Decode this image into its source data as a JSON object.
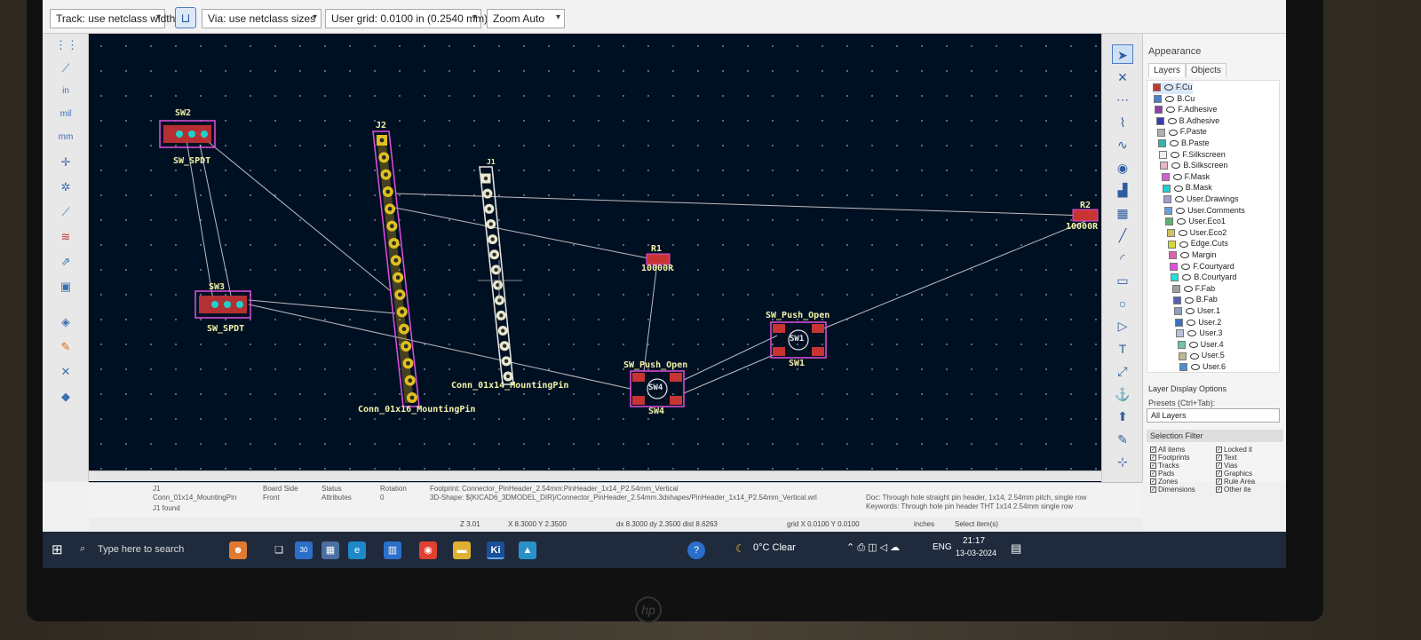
{
  "toolbar": {
    "track_select": "Track: use netclass width",
    "via_select": "Via: use netclass sizes",
    "grid_select": "User grid: 0.0100 in (0.2540 mm)",
    "zoom_select": "Zoom Auto"
  },
  "left_tools": [
    "grid-icon",
    "ruler-icon",
    "in",
    "mil",
    "mm",
    "cursor-icon",
    "ratsnest-icon",
    "via-icon",
    "track-icon",
    "zone-icon",
    "pad-icon",
    "3d-icon",
    "graphics-icon",
    "cross-icon",
    "layer-icon"
  ],
  "left_tool_labels": {
    "in": "in",
    "mil": "mil",
    "mm": "mm"
  },
  "right_tools": [
    "select-icon",
    "highlight-icon",
    "route-icon",
    "diff-pair-icon",
    "tune-icon",
    "via-icon",
    "zone-icon",
    "keepout-icon",
    "line-icon",
    "arc-icon",
    "rect-icon",
    "circle-icon",
    "polygon-icon",
    "text-icon",
    "dimension-icon",
    "anchor-icon",
    "origin-icon",
    "measure-icon",
    "grid-origin-icon"
  ],
  "appearance": {
    "title": "Appearance",
    "tab_layers": "Layers",
    "tab_objects": "Objects",
    "layers": [
      {
        "name": "F.Cu",
        "color": "#c83434"
      },
      {
        "name": "B.Cu",
        "color": "#4d7fc4"
      },
      {
        "name": "F.Adhesive",
        "color": "#8e3ea6"
      },
      {
        "name": "B.Adhesive",
        "color": "#3a3bb0"
      },
      {
        "name": "F.Paste",
        "color": "#b0b0b0"
      },
      {
        "name": "B.Paste",
        "color": "#32b6b0"
      },
      {
        "name": "F.Silkscreen",
        "color": "#f0f0f0"
      },
      {
        "name": "B.Silkscreen",
        "color": "#e8b4c8"
      },
      {
        "name": "F.Mask",
        "color": "#d060d0"
      },
      {
        "name": "B.Mask",
        "color": "#20d0d0"
      },
      {
        "name": "User.Drawings",
        "color": "#9aa0c8"
      },
      {
        "name": "User.Comments",
        "color": "#6aa0d8"
      },
      {
        "name": "User.Eco1",
        "color": "#60b070"
      },
      {
        "name": "User.Eco2",
        "color": "#d0c060"
      },
      {
        "name": "Edge.Cuts",
        "color": "#d8d838"
      },
      {
        "name": "Margin",
        "color": "#e060b0"
      },
      {
        "name": "F.Courtyard",
        "color": "#e050e0"
      },
      {
        "name": "B.Courtyard",
        "color": "#20e0e0"
      },
      {
        "name": "F.Fab",
        "color": "#a0a0a0"
      },
      {
        "name": "B.Fab",
        "color": "#5860b0"
      },
      {
        "name": "User.1",
        "color": "#8aa0c0"
      },
      {
        "name": "User.2",
        "color": "#3a70c0"
      },
      {
        "name": "User.3",
        "color": "#b8c0d8"
      },
      {
        "name": "User.4",
        "color": "#70c0b0"
      },
      {
        "name": "User.5",
        "color": "#c0b890"
      },
      {
        "name": "User.6",
        "color": "#4a90d0"
      }
    ],
    "layer_display_options": "Layer Display Options",
    "presets_label": "Presets (Ctrl+Tab):",
    "presets_value": "All Layers",
    "selection_filter": "Selection Filter",
    "filters": [
      {
        "label": "All items",
        "checked": true
      },
      {
        "label": "Locked it",
        "checked": true
      },
      {
        "label": "Footprints",
        "checked": true
      },
      {
        "label": "Text",
        "checked": true
      },
      {
        "label": "Tracks",
        "checked": true
      },
      {
        "label": "Vias",
        "checked": true
      },
      {
        "label": "Pads",
        "checked": true
      },
      {
        "label": "Graphics",
        "checked": true
      },
      {
        "label": "Zones",
        "checked": true
      },
      {
        "label": "Rule Area",
        "checked": true
      },
      {
        "label": "Dimensions",
        "checked": true
      },
      {
        "label": "Other ite",
        "checked": true
      }
    ]
  },
  "pcb": {
    "sw2_ref": "SW2",
    "sw2_val": "SW_SPDT",
    "sw3_ref": "SW3",
    "sw3_val": "SW_SPDT",
    "j2_ref": "J2",
    "j2_val": "Conn_01x16_MountingPin",
    "j1_ref": "J1",
    "j1_val": "Conn_01x14_MountingPin",
    "r1_ref": "R1",
    "r1_val": "10000R",
    "r2_ref": "R2",
    "r2_val": "10000R",
    "sw4_ref": "SW4",
    "sw4_val": "SW_Push_Open",
    "sw4_center": "SW4",
    "sw1_ref": "SW1",
    "sw1_val": "SW_Push_Open",
    "sw1_center": "SW1"
  },
  "message_panel": {
    "ref": "J1",
    "value": "Conn_01x14_MountingPin",
    "found": "J1 found",
    "board_side_label": "Board Side",
    "board_side_value": "Front",
    "status_label": "Status",
    "attributes_label": "Attributes",
    "rotation_label": "Rotation",
    "rotation_value": "0",
    "footprint": "Footprint: Connector_PinHeader_2.54mm:PinHeader_1x14_P2.54mm_Vertical",
    "shape3d": "3D-Shape: ${KICAD6_3DMODEL_DIR}/Connector_PinHeader_2.54mm.3dshapes/PinHeader_1x14_P2.54mm_Vertical.wrl",
    "doc": "Doc: Through hole straight pin header, 1x14, 2.54mm pitch, single row",
    "keywords": "Keywords: Through hole pin header THT 1x14 2.54mm single row"
  },
  "status": {
    "z": "Z 3.01",
    "xy": "X 8.3000  Y 2.3500",
    "dxdy": "dx 8.3000  dy 2.3500  dist 8.6263",
    "grid": "grid X 0.0100  Y 0.0100",
    "units": "inches",
    "select": "Select item(s)"
  },
  "taskbar": {
    "search_placeholder": "Type here to search",
    "weather": "0°C  Clear",
    "lang": "ENG",
    "time": "21:17",
    "date": "13-03-2024",
    "kicad_label": "Ki",
    "calendar_badge": "30"
  },
  "monitor_brand": "hp"
}
